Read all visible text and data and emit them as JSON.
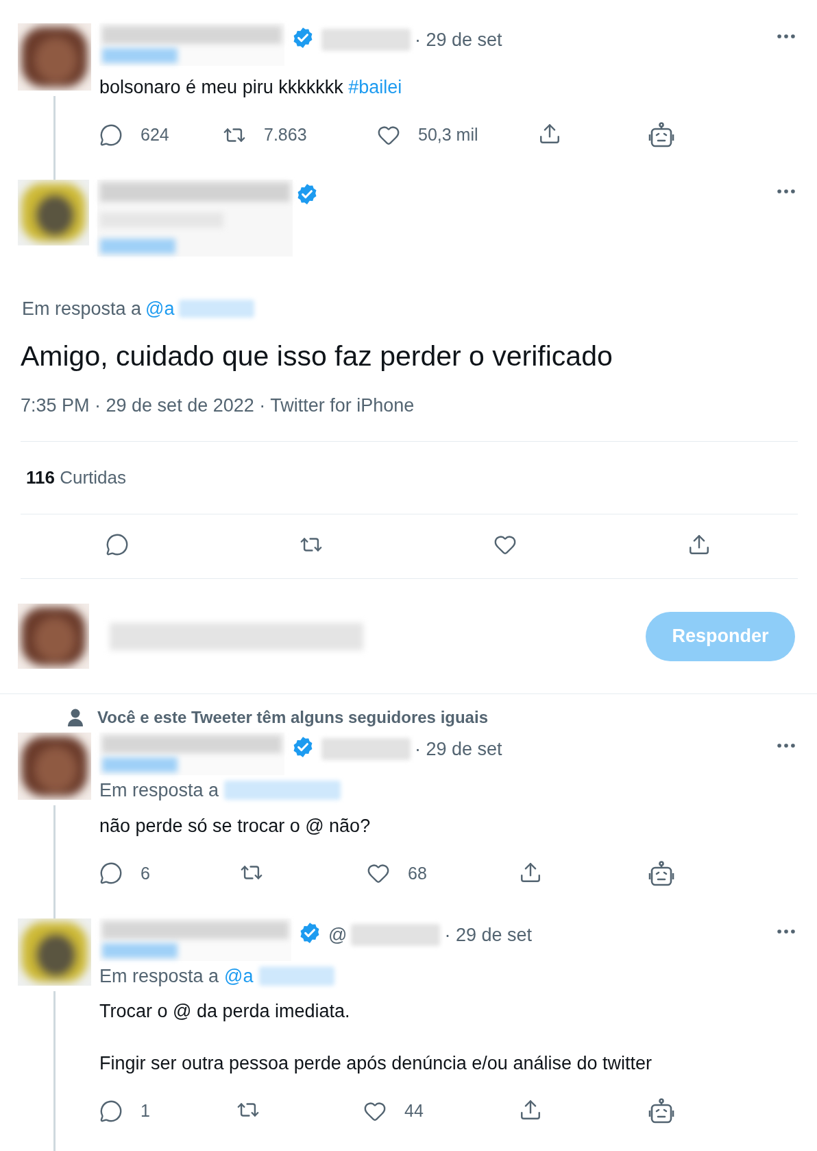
{
  "thread": [
    {
      "kind": "compact",
      "verified": true,
      "date": "· 29 de set",
      "text": "bolsonaro é meu piru kkkkkkk",
      "hashtag": "#bailei",
      "thread_line": true,
      "actions": [
        {
          "kind": "reply",
          "count": "624"
        },
        {
          "kind": "retweet",
          "count": "7.863"
        },
        {
          "kind": "like",
          "count": "50,3 mil"
        },
        {
          "kind": "share"
        },
        {
          "kind": "bot"
        }
      ]
    },
    {
      "kind": "main",
      "verified": true,
      "reply_to": "Em resposta a",
      "reply_handle": "@a",
      "text": "Amigo, cuidado que isso faz perder o verificado",
      "meta": "7:35 PM · 29 de set de 2022 · Twitter for iPhone",
      "likes_count": "116",
      "likes_label": "Curtidas",
      "actions": [
        {
          "kind": "reply"
        },
        {
          "kind": "retweet"
        },
        {
          "kind": "like"
        },
        {
          "kind": "share"
        }
      ]
    }
  ],
  "composer": {
    "button": "Responder",
    "disabled": true
  },
  "social_context": "Você e este Tweeter têm alguns seguidores iguais",
  "replies": [
    {
      "kind": "compact",
      "verified": true,
      "date": "· 29 de set",
      "reply_to": "Em resposta a",
      "text": "não perde só se trocar o @ não?",
      "thread_line": true,
      "actions": [
        {
          "kind": "reply",
          "count": "6"
        },
        {
          "kind": "retweet"
        },
        {
          "kind": "like",
          "count": "68"
        },
        {
          "kind": "share"
        },
        {
          "kind": "bot"
        }
      ]
    },
    {
      "kind": "compact",
      "verified": true,
      "handle_prefix": "@",
      "date": "· 29 de set",
      "reply_to": "Em resposta a",
      "reply_handle": "@a",
      "text": "Trocar o @ da perda imediata.",
      "text_2": "Fingir ser outra pessoa perde após denúncia e/ou análise do twitter",
      "thread_line": true,
      "actions": [
        {
          "kind": "reply",
          "count": "1"
        },
        {
          "kind": "retweet"
        },
        {
          "kind": "like",
          "count": "44"
        },
        {
          "kind": "share"
        },
        {
          "kind": "bot"
        }
      ]
    }
  ]
}
